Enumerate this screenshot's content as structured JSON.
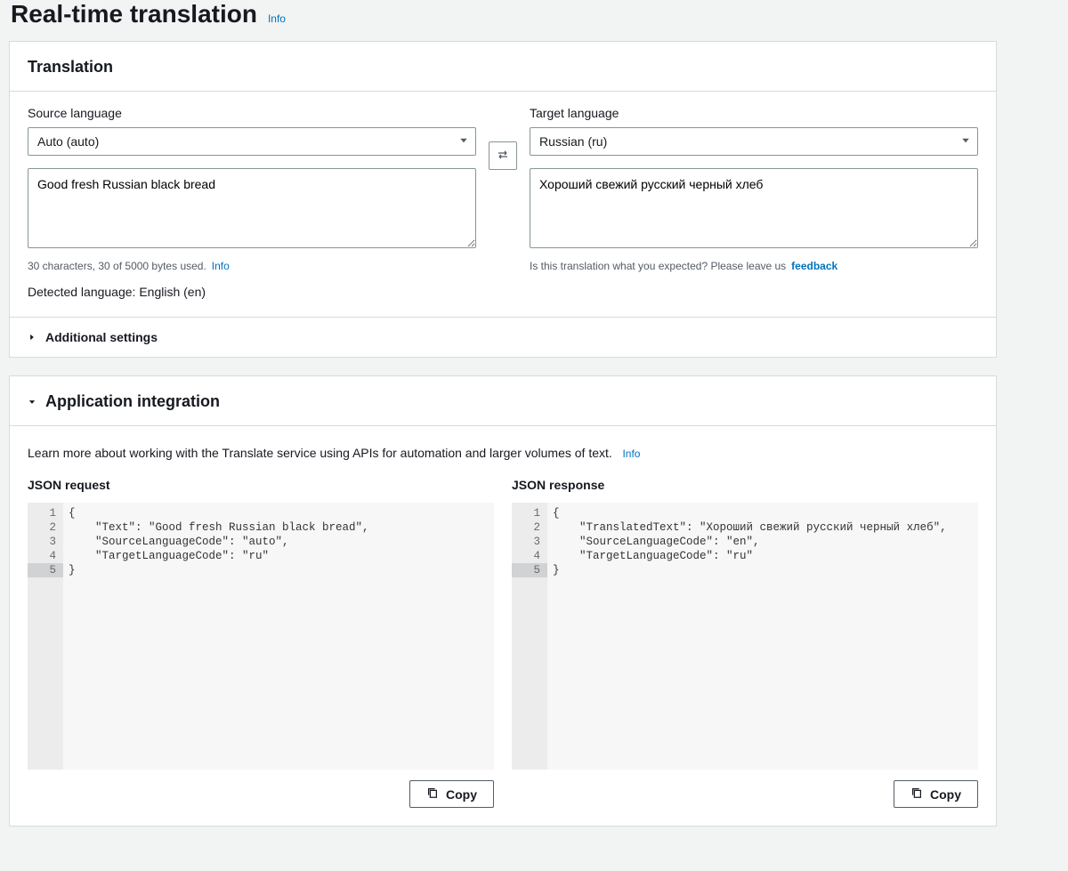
{
  "header": {
    "title": "Real-time translation",
    "info": "Info"
  },
  "translation": {
    "panel_title": "Translation",
    "source_label": "Source language",
    "target_label": "Target language",
    "source_selected": "Auto (auto)",
    "target_selected": "Russian (ru)",
    "source_text": "Good fresh Russian black bread",
    "target_text": "Хороший свежий русский черный хлеб",
    "char_count": "30 characters, 30 of 5000 bytes used.",
    "char_info": "Info",
    "detected": "Detected language: English (en)",
    "feedback_q": "Is this translation what you expected? Please leave us",
    "feedback_link": "feedback",
    "additional_settings": "Additional settings"
  },
  "app_integration": {
    "title": "Application integration",
    "description": "Learn more about working with the Translate service using APIs for automation and larger volumes of text.",
    "info": "Info",
    "json_request_label": "JSON request",
    "json_response_label": "JSON response",
    "json_request_lines": [
      "{",
      "    \"Text\": \"Good fresh Russian black bread\",",
      "    \"SourceLanguageCode\": \"auto\",",
      "    \"TargetLanguageCode\": \"ru\"",
      "}"
    ],
    "json_response_lines": [
      "{",
      "    \"TranslatedText\": \"Хороший свежий русский черный хлеб\",",
      "    \"SourceLanguageCode\": \"en\",",
      "    \"TargetLanguageCode\": \"ru\"",
      "}"
    ],
    "copy": "Copy"
  }
}
